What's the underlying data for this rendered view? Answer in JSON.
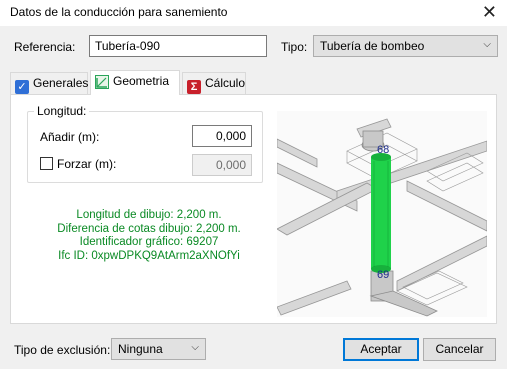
{
  "window": {
    "title": "Datos de la conducción para sanemiento"
  },
  "header": {
    "referencia_label": "Referencia:",
    "referencia_value": "Tubería-090",
    "tipo_label": "Tipo:",
    "tipo_value": "Tubería de bombeo"
  },
  "tabs": [
    {
      "label": "Generales",
      "icon": "checkbox-icon",
      "color": "#2f6fd6"
    },
    {
      "label": "Geometria",
      "icon": "geometry-icon",
      "color": "#2aa55a"
    },
    {
      "label": "Cálculo",
      "icon": "sigma-icon",
      "color": "#c8202b"
    }
  ],
  "longitud": {
    "group_title": "Longitud:",
    "anadir_label": "Añadir (m):",
    "anadir_value": "0,000",
    "forzar_label": "Forzar (m):",
    "forzar_value": "0,000",
    "forzar_checked": false
  },
  "info": {
    "line1": "Longitud de dibujo: 2,200 m.",
    "line2": "Diferencia de cotas dibujo: 2,200 m.",
    "line3": "Identificador gráfico: 69207",
    "line4": "Ifc ID: 0xpwDPKQ9AtArm2aXNOfYi"
  },
  "view": {
    "node_top": "68",
    "node_bottom": "69",
    "pipe_color": "#1fd24a"
  },
  "footer": {
    "exclusion_label": "Tipo de exclusión:",
    "exclusion_value": "Ninguna",
    "accept_label": "Aceptar",
    "cancel_label": "Cancelar"
  }
}
